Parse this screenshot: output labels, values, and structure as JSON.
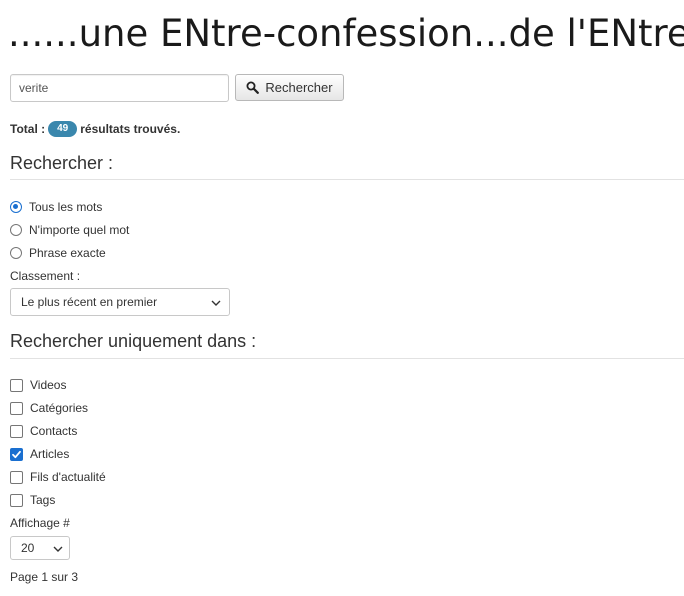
{
  "page": {
    "title": "......une ENtre-confession...de l'ENtre...."
  },
  "search": {
    "value": "verite",
    "button_label": "Rechercher"
  },
  "results": {
    "total_label": "Total :",
    "count": "49",
    "suffix": "résultats trouvés."
  },
  "search_section": {
    "heading": "Rechercher :",
    "match_options": [
      {
        "label": "Tous les mots",
        "checked": true
      },
      {
        "label": "N'importe quel mot",
        "checked": false
      },
      {
        "label": "Phrase exacte",
        "checked": false
      }
    ],
    "ordering_label": "Classement :",
    "ordering_value": "Le plus récent en premier"
  },
  "areas_section": {
    "heading": "Rechercher uniquement dans :",
    "areas": [
      {
        "label": "Videos",
        "checked": false
      },
      {
        "label": "Catégories",
        "checked": false
      },
      {
        "label": "Contacts",
        "checked": false
      },
      {
        "label": "Articles",
        "checked": true
      },
      {
        "label": "Fils d'actualité",
        "checked": false
      },
      {
        "label": "Tags",
        "checked": false
      }
    ]
  },
  "display": {
    "limit_label": "Affichage #",
    "limit_value": "20"
  },
  "pagination": {
    "counter": "Page 1 sur 3"
  },
  "colors": {
    "accent": "#1a6fd0",
    "badge": "#3a87ad"
  },
  "icons": {
    "search_button": "search-icon",
    "select": "chevron-down-icon",
    "checked_box": "checkmark-icon"
  }
}
